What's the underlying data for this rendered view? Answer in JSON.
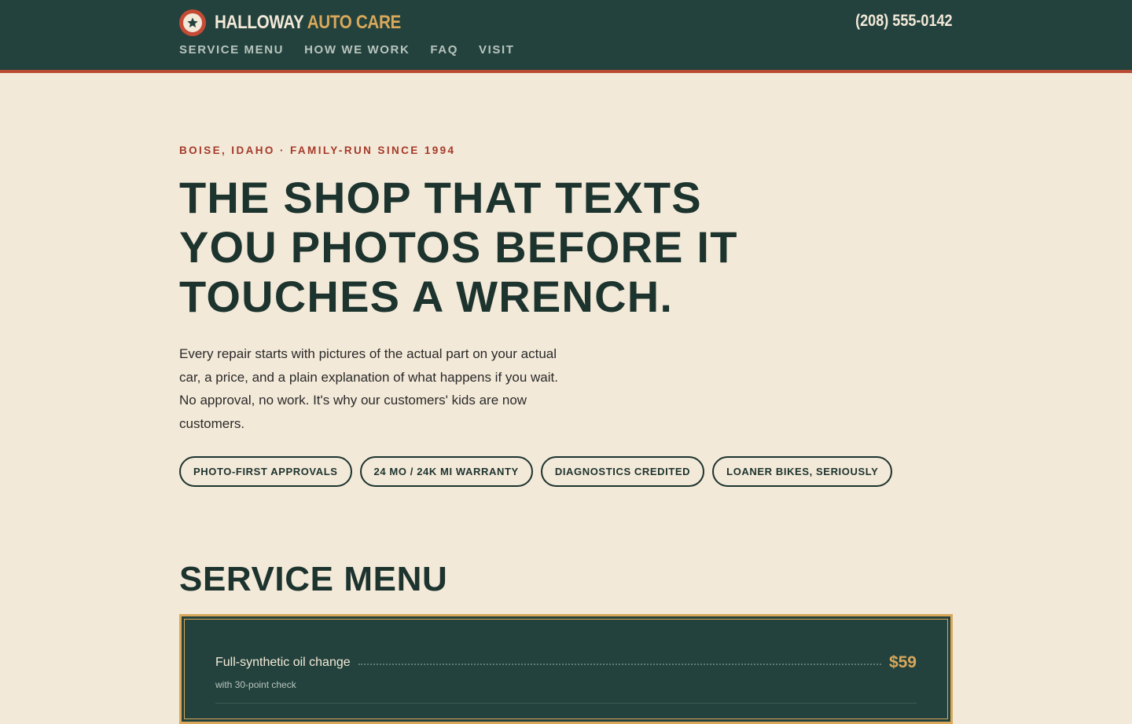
{
  "brand": {
    "name_white": "HALLOWAY",
    "name_accent": "AUTO CARE",
    "logo_icon": "star-badge-icon"
  },
  "header": {
    "phone": "(208) 555-0142"
  },
  "nav": {
    "items": [
      "SERVICE MENU",
      "HOW WE WORK",
      "FAQ",
      "VISIT"
    ]
  },
  "hero": {
    "eyebrow": "BOISE, IDAHO · FAMILY-RUN SINCE 1994",
    "headline": "THE SHOP THAT TEXTS YOU PHOTOS BEFORE IT TOUCHES A WRENCH.",
    "lede": "Every repair starts with pictures of the actual part on your actual car, a price, and a plain explanation of what happens if you wait. No approval, no work. It's why our customers' kids are now customers.",
    "pills": [
      "PHOTO-FIRST APPROVALS",
      "24 MO / 24K MI WARRANTY",
      "DIAGNOSTICS CREDITED",
      "LOANER BIKES, SERIOUSLY"
    ]
  },
  "service_menu": {
    "title": "SERVICE MENU",
    "items": [
      {
        "name": "Full-synthetic oil change",
        "sub": "with 30-point check",
        "price": "$59"
      }
    ]
  },
  "colors": {
    "header_bg": "#23423d",
    "accent_red": "#b94a34",
    "accent_gold": "#d9a85b",
    "page_bg": "#f3e9d8",
    "ink": "#1c332e"
  }
}
